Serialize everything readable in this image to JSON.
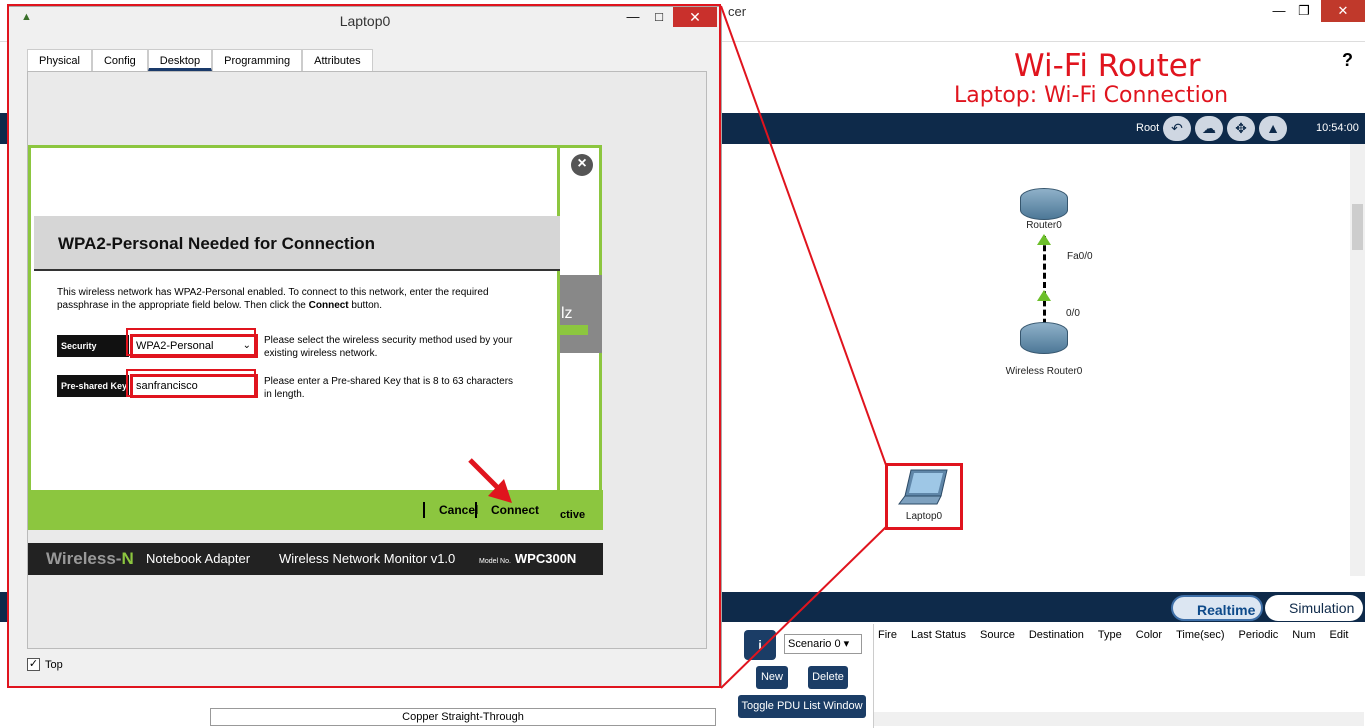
{
  "background_window": {
    "title_fragment": "cer",
    "minimize_icon": "minimize-icon",
    "maximize_icon": "restore-icon",
    "close_icon": "close-icon",
    "help_label": "?"
  },
  "overlay": {
    "title": "Wi-Fi Router",
    "subtitle": "Laptop: Wi-Fi Connection",
    "color": "#e0141e"
  },
  "navbar": {
    "root_label": "Root",
    "time": "10:54:00"
  },
  "topology": {
    "router_label": "Router0",
    "router_port": "Fa0/0",
    "wireless_router_label": "Wireless Router0",
    "wireless_port": "0/0",
    "laptop_label": "Laptop0"
  },
  "mode": {
    "realtime_label": "Realtime",
    "simulation_label": "Simulation"
  },
  "scenario": {
    "selected": "Scenario 0",
    "new_label": "New",
    "delete_label": "Delete",
    "toggle_label": "Toggle PDU List Window"
  },
  "pdu_columns": [
    "Fire",
    "Last Status",
    "Source",
    "Destination",
    "Type",
    "Color",
    "Time(sec)",
    "Periodic",
    "Num",
    "Edit"
  ],
  "cable_label": "Copper Straight-Through",
  "dialog": {
    "title": "Laptop0",
    "tabs": [
      "Physical",
      "Config",
      "Desktop",
      "Programming",
      "Attributes"
    ],
    "active_tab": "Desktop",
    "top_label": "Top",
    "top_checked": true
  },
  "app": {
    "header_title": "WPA2-Personal Needed for Connection",
    "desc_line1": "This wireless network has WPA2-Personal enabled. To connect to this network, enter the required",
    "desc_line2_pre": "passphrase in the appropriate field below. Then click the ",
    "desc_line2_bold": "Connect",
    "desc_line2_post": " button.",
    "security_label": "Security",
    "security_value": "WPA2-Personal",
    "security_help_1": "Please select the wireless security method used by your",
    "security_help_2": "existing wireless network.",
    "key_label": "Pre-shared Key",
    "key_value": "sanfrancisco",
    "key_help_1": "Please enter a Pre-shared Key that is 8 to 63 characters",
    "key_help_2": "in length.",
    "cancel_label": "Cancel",
    "connect_label": "Connect",
    "back_partial_text": "ctive",
    "back_partial_z": "lz",
    "brand_wireless": "Wireless-",
    "brand_n": "N",
    "brand_adapter": "Notebook Adapter",
    "brand_monitor": "Wireless Network Monitor  v1.0",
    "model_prefix": "Model No.",
    "model": "WPC300N",
    "accent_green": "#8cc63f"
  }
}
